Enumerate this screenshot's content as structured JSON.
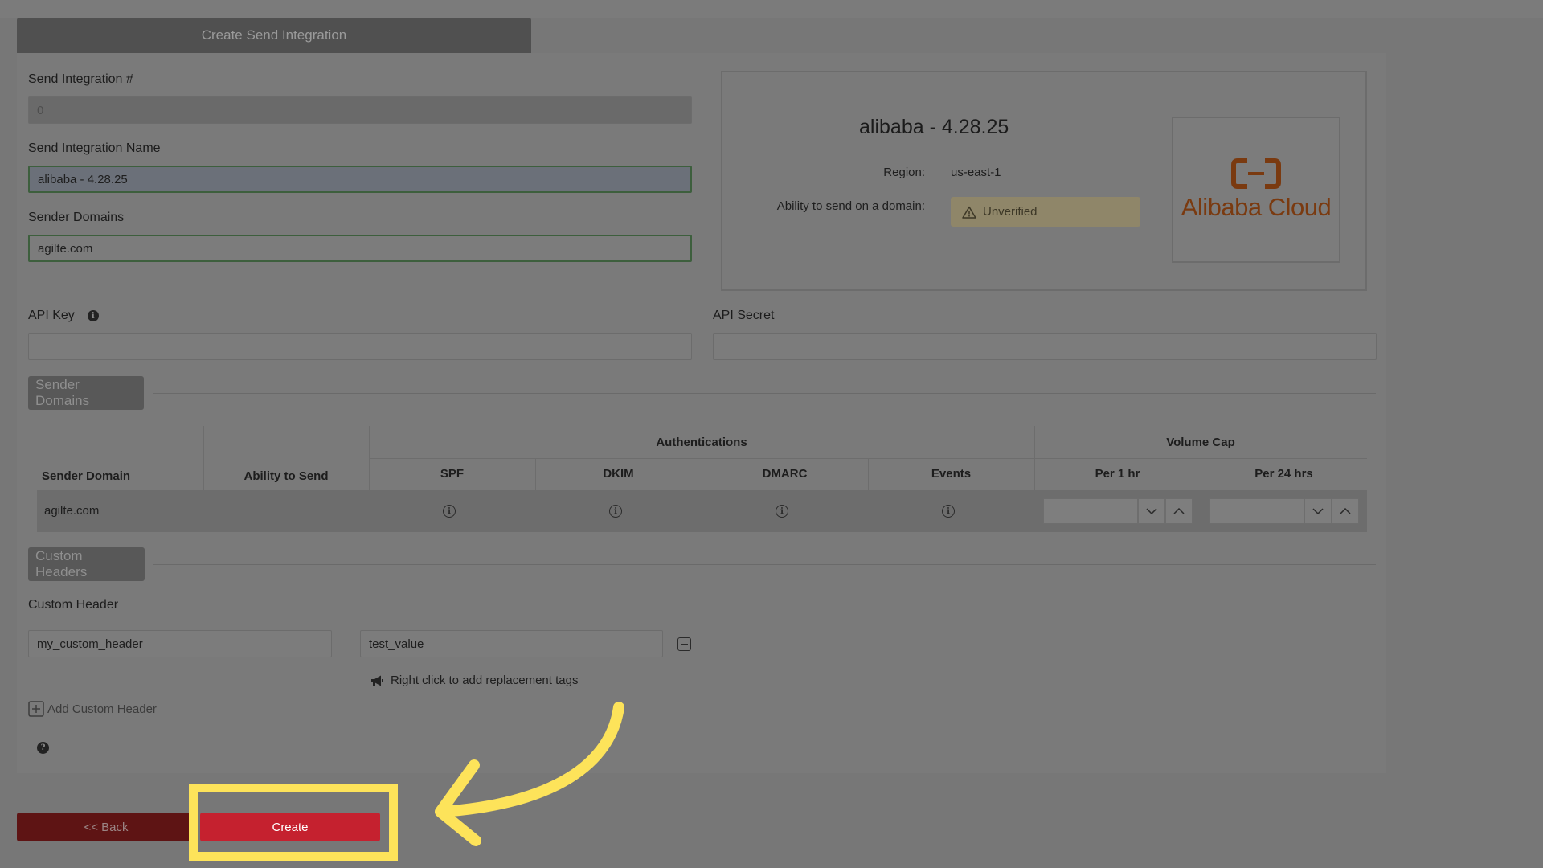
{
  "header": {
    "tab_title": "Create Send Integration"
  },
  "form": {
    "integration_number_label": "Send Integration #",
    "integration_number_value": "0",
    "integration_name_label": "Send Integration Name",
    "integration_name_value": "alibaba - 4.28.25",
    "sender_domains_label": "Sender Domains",
    "sender_domains_value": "agilte.com",
    "api_key_label": "API Key",
    "api_key_value": "",
    "api_secret_label": "API Secret",
    "api_secret_value": ""
  },
  "summary": {
    "title": "alibaba - 4.28.25",
    "region_label": "Region:",
    "region_value": "us-east-1",
    "ability_label": "Ability to send on a domain:",
    "status": "Unverified",
    "status_color": "#8f8669",
    "logo_text": "Alibaba Cloud",
    "logo_color": "#7a3a10"
  },
  "sender_domains_section": {
    "title": "Sender Domains",
    "columns": {
      "sender_domain": "Sender Domain",
      "ability_to_send": "Ability to Send",
      "authentications": "Authentications",
      "spf": "SPF",
      "dkim": "DKIM",
      "dmarc": "DMARC",
      "events": "Events",
      "volume_cap": "Volume Cap",
      "per_1hr": "Per 1 hr",
      "per_24hrs": "Per 24 hrs"
    },
    "rows": [
      {
        "domain": "agilte.com",
        "ability": ""
      }
    ]
  },
  "custom_headers_section": {
    "title": "Custom Headers",
    "header_label": "Custom Header",
    "header_name_value": "my_custom_header",
    "header_value_value": "test_value",
    "hint": "Right click to add replacement tags",
    "add_label": "Add Custom Header"
  },
  "footer": {
    "back_label": "<< Back",
    "create_label": "Create",
    "create_color": "#c5212f",
    "highlight_color": "#fde35a"
  }
}
